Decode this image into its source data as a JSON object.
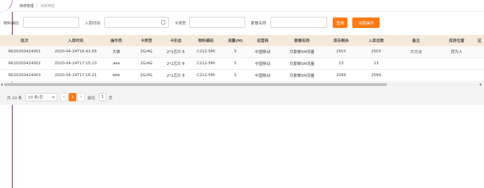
{
  "breadcrumb": {
    "main": "库存管理",
    "separator": "|",
    "sub": "出库筛选"
  },
  "filters": {
    "material_code_label": "物料编码",
    "material_code_value": "",
    "inbound_time_label": "入库时间",
    "inbound_time_value": "",
    "card_type_label": "卡类型",
    "card_type_value": "",
    "package_name_label": "套餐名称",
    "package_name_value": "",
    "query_button": "查询",
    "outbound_button": "出库操作",
    "icons": {
      "date_picker": "calendar-icon"
    }
  },
  "table": {
    "columns": [
      "批次",
      "入库时间",
      "操作员",
      "卡类型",
      "卡形态",
      "物料编码",
      "流量(M)",
      "运营商",
      "套餐名称",
      "库存剩余",
      "入库总数",
      "备注",
      "库房位置",
      "区"
    ],
    "rows": [
      [
        "RK20200424001",
        "2020-04-24T16:41:56",
        "大卿",
        "2G/4G",
        "2*2芯片卡",
        "C212-5Mi",
        "5",
        "中国移动",
        "月套餐5M流量",
        "2503",
        "2503",
        "大方法",
        "而为人",
        ""
      ],
      [
        "RK20200424002",
        "2020-04-24T17:15:10",
        "aaa",
        "2G/4G",
        "2*2芯片卡",
        "C212-5Mi",
        "5",
        "中国移动",
        "月套餐5M流量",
        "13",
        "13",
        "",
        "",
        ""
      ],
      [
        "RK20200424003",
        "2020-04-24T17:16:21",
        "bbb",
        "2G/4G",
        "2*2芯片卡",
        "C212-5Mi",
        "5",
        "中国移动",
        "月套餐5M流量",
        "2099",
        "2099",
        "",
        "",
        ""
      ]
    ]
  },
  "pagination": {
    "total": "共 10 条",
    "page_size": "10 条/页",
    "prev": "<",
    "current": "1",
    "next": ">",
    "goto_label": "前往",
    "goto_value": "1",
    "page_suffix": "页"
  },
  "colors": {
    "accent": "#ff7a12",
    "header_bg": "#f5e9dc",
    "sidebar_line": "#6b2d2d"
  }
}
